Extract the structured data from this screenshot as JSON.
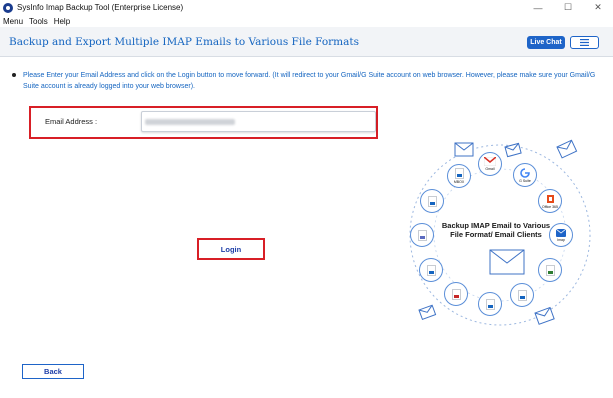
{
  "window": {
    "title": "SysInfo Imap Backup Tool (Enterprise License)"
  },
  "menubar": [
    "Menu",
    "Tools",
    "Help"
  ],
  "header": {
    "title": "Backup and Export Multiple IMAP Emails to Various File Formats",
    "live_chat_label": "Live Chat"
  },
  "instruction": "Please Enter your Email Address and click on the Login button to move forward. (It will redirect to your Gmail/G Suite account on web browser. However, please make sure your Gmail/G Suite account is already logged into your web browser).",
  "form": {
    "email_label": "Email Address :",
    "email_value": "",
    "login_label": "Login"
  },
  "footer": {
    "back_label": "Back"
  },
  "graphic": {
    "center_text": "Backup IMAP Email to Various File Format/ Email Clients",
    "nodes": [
      "Gmail",
      "G Suite",
      "Office 365",
      "Imap"
    ]
  },
  "colors": {
    "accent": "#1565c0",
    "button_blue": "#1e64c8",
    "highlight_red": "#d81f26"
  },
  "icons": [
    "app-icon",
    "minimize-icon",
    "maximize-icon",
    "close-icon",
    "hamburger-icon",
    "envelope-icon",
    "gmail-icon",
    "gsuite-icon",
    "office365-icon",
    "imap-icon",
    "file-format-icon"
  ]
}
